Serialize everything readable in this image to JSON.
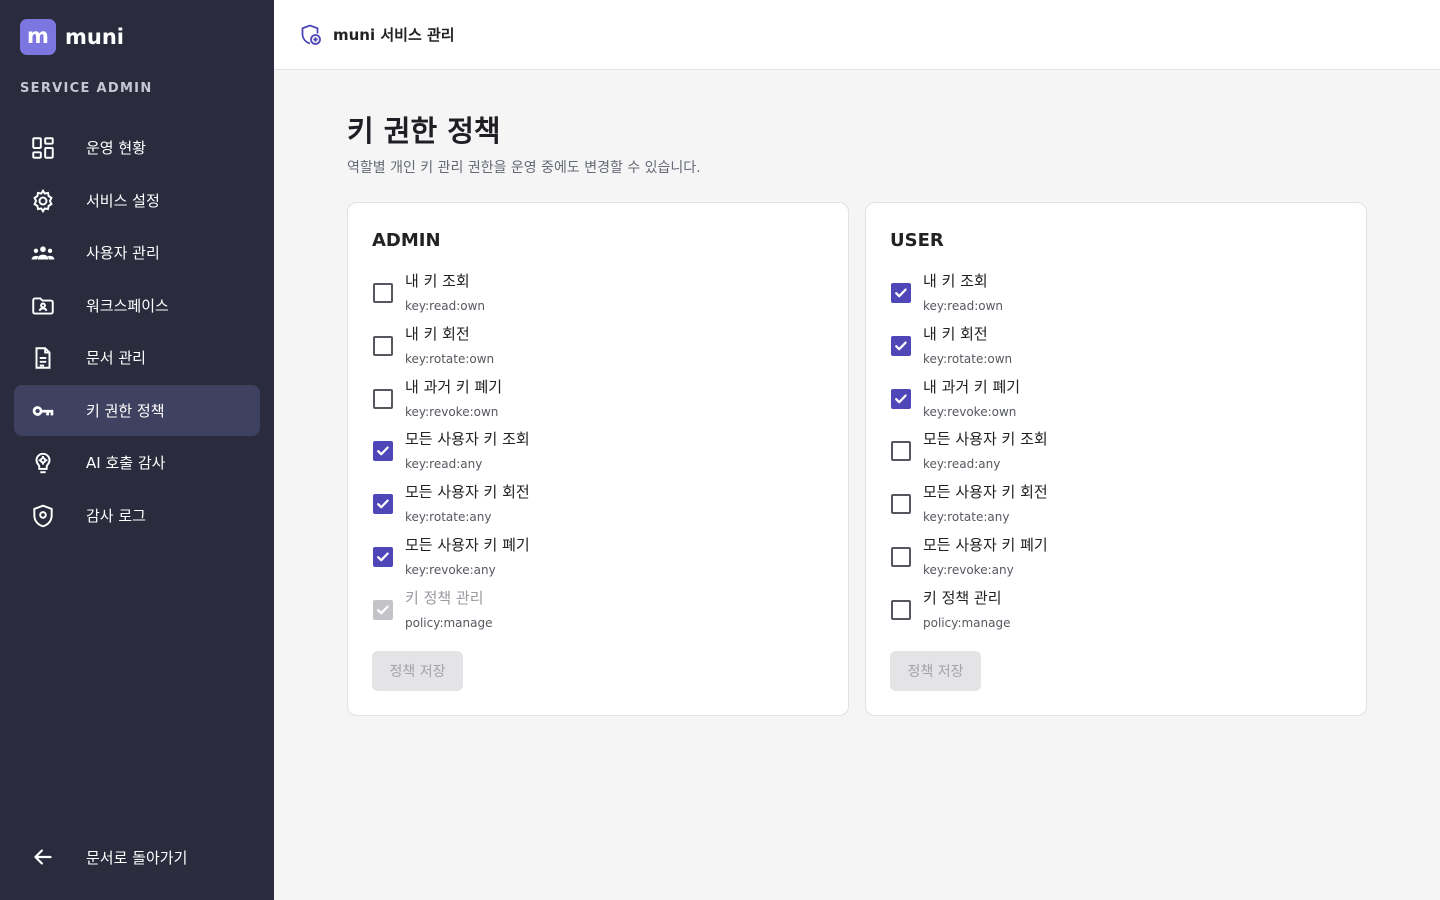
{
  "brand": {
    "mark": "m",
    "name": "muni"
  },
  "sidebar": {
    "section_label": "SERVICE ADMIN",
    "items": [
      {
        "label": "운영 현황",
        "icon": "dashboard-icon",
        "active": false
      },
      {
        "label": "서비스 설정",
        "icon": "gear-icon",
        "active": false
      },
      {
        "label": "사용자 관리",
        "icon": "users-icon",
        "active": false
      },
      {
        "label": "워크스페이스",
        "icon": "workspace-folder-icon",
        "active": false
      },
      {
        "label": "문서 관리",
        "icon": "document-icon",
        "active": false
      },
      {
        "label": "키 권한 정책",
        "icon": "key-icon",
        "active": true
      },
      {
        "label": "AI 호출 감사",
        "icon": "brain-icon",
        "active": false
      },
      {
        "label": "감사 로그",
        "icon": "shield-icon",
        "active": false
      }
    ],
    "back_label": "문서로 돌아가기"
  },
  "topbar": {
    "title": "muni 서비스 관리",
    "icon": "shield-settings-icon"
  },
  "page": {
    "title": "키 권한 정책",
    "subtitle": "역할별 개인 키 관리 권한을 운영 중에도 변경할 수 있습니다."
  },
  "cards": {
    "admin": {
      "title": "ADMIN",
      "save_label": "정책 저장",
      "permissions": [
        {
          "label": "내 키 조회",
          "code": "key:read:own",
          "checked": false,
          "disabled": false
        },
        {
          "label": "내 키 회전",
          "code": "key:rotate:own",
          "checked": false,
          "disabled": false
        },
        {
          "label": "내 과거 키 폐기",
          "code": "key:revoke:own",
          "checked": false,
          "disabled": false
        },
        {
          "label": "모든 사용자 키 조회",
          "code": "key:read:any",
          "checked": true,
          "disabled": false
        },
        {
          "label": "모든 사용자 키 회전",
          "code": "key:rotate:any",
          "checked": true,
          "disabled": false
        },
        {
          "label": "모든 사용자 키 폐기",
          "code": "key:revoke:any",
          "checked": true,
          "disabled": false
        },
        {
          "label": "키 정책 관리",
          "code": "policy:manage",
          "checked": true,
          "disabled": true
        }
      ]
    },
    "user": {
      "title": "USER",
      "save_label": "정책 저장",
      "permissions": [
        {
          "label": "내 키 조회",
          "code": "key:read:own",
          "checked": true,
          "disabled": false
        },
        {
          "label": "내 키 회전",
          "code": "key:rotate:own",
          "checked": true,
          "disabled": false
        },
        {
          "label": "내 과거 키 폐기",
          "code": "key:revoke:own",
          "checked": true,
          "disabled": false
        },
        {
          "label": "모든 사용자 키 조회",
          "code": "key:read:any",
          "checked": false,
          "disabled": false
        },
        {
          "label": "모든 사용자 키 회전",
          "code": "key:rotate:any",
          "checked": false,
          "disabled": false
        },
        {
          "label": "모든 사용자 키 폐기",
          "code": "key:revoke:any",
          "checked": false,
          "disabled": false
        },
        {
          "label": "키 정책 관리",
          "code": "policy:manage",
          "checked": false,
          "disabled": false
        }
      ]
    }
  },
  "colors": {
    "sidebar_bg": "#2a2c3e",
    "sidebar_active": "#3f4160",
    "accent": "#4f47b8",
    "brand_mark": "#7c76e0"
  }
}
